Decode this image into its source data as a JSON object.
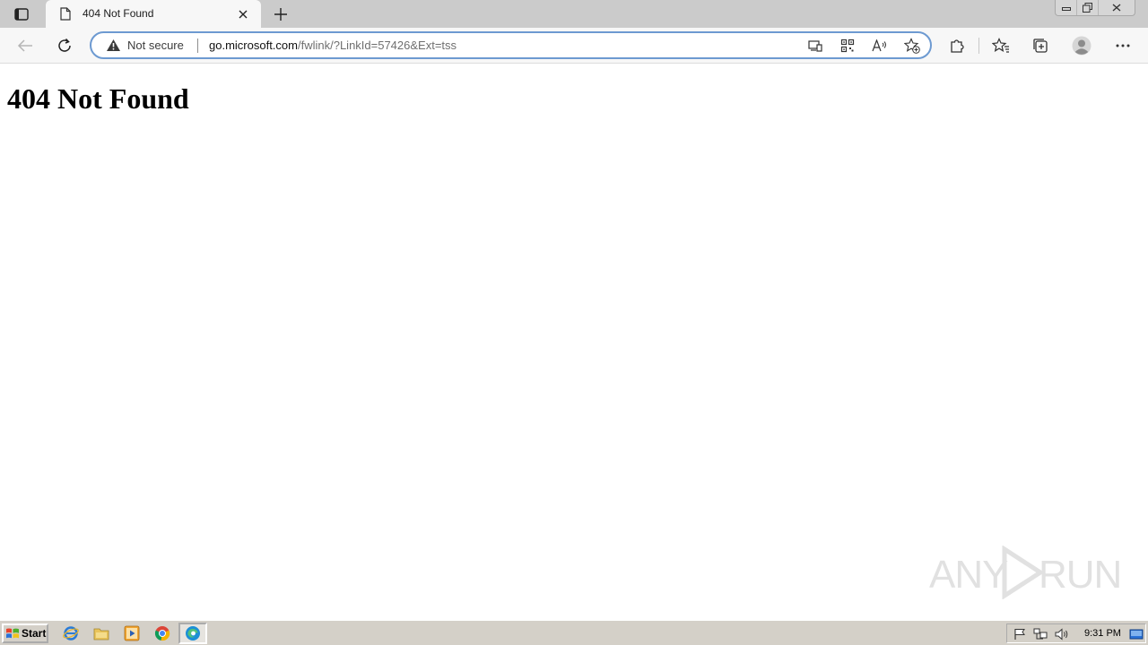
{
  "browser": {
    "tab": {
      "title": "404 Not Found"
    },
    "address_bar": {
      "security_label": "Not secure",
      "url_host": "go.microsoft.com",
      "url_path": "/fwlink/?LinkId=57426&Ext=tss"
    }
  },
  "page": {
    "heading": "404 Not Found"
  },
  "watermark": {
    "left_text": "ANY",
    "right_text": "RUN"
  },
  "taskbar": {
    "start_label": "Start",
    "clock": "9:31 PM"
  },
  "colors": {
    "tab_strip": "#cbcbcb",
    "toolbar": "#f7f7f7",
    "address_border": "#6d9ad1",
    "taskbar": "#d4d0c8"
  },
  "icons": {
    "tab_actions": "tab-actions-icon",
    "favicon": "page-icon",
    "close": "close-icon",
    "new_tab": "plus-icon",
    "back": "back-arrow-icon",
    "refresh": "refresh-icon",
    "warning": "warning-icon",
    "extensions": "puzzle-icon",
    "favorites": "favorites-icon",
    "collections": "collections-icon",
    "profile": "profile-icon",
    "menu": "more-icon"
  }
}
